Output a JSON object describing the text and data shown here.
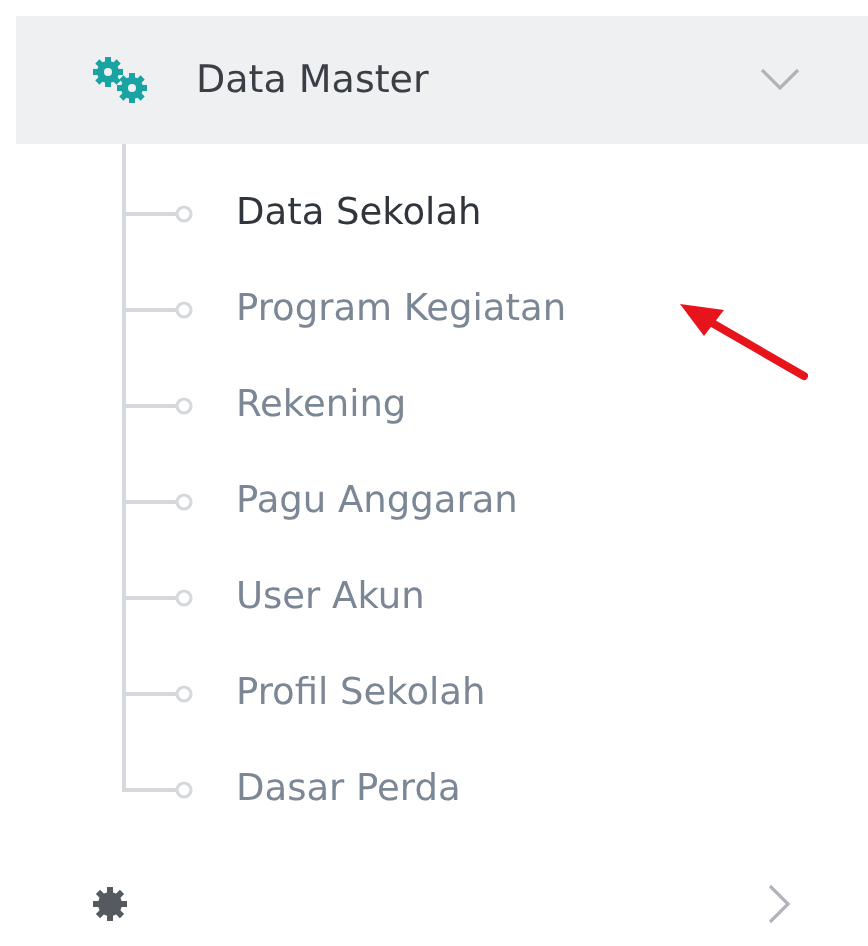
{
  "menu": {
    "label": "Data Master",
    "expanded": true,
    "items": [
      {
        "label": "Data Sekolah",
        "selected": true
      },
      {
        "label": "Program Kegiatan",
        "selected": false
      },
      {
        "label": "Rekening",
        "selected": false
      },
      {
        "label": "Pagu Anggaran",
        "selected": false
      },
      {
        "label": "User Akun",
        "selected": false
      },
      {
        "label": "Profil Sekolah",
        "selected": false
      },
      {
        "label": "Dasar Perda",
        "selected": false
      }
    ]
  }
}
